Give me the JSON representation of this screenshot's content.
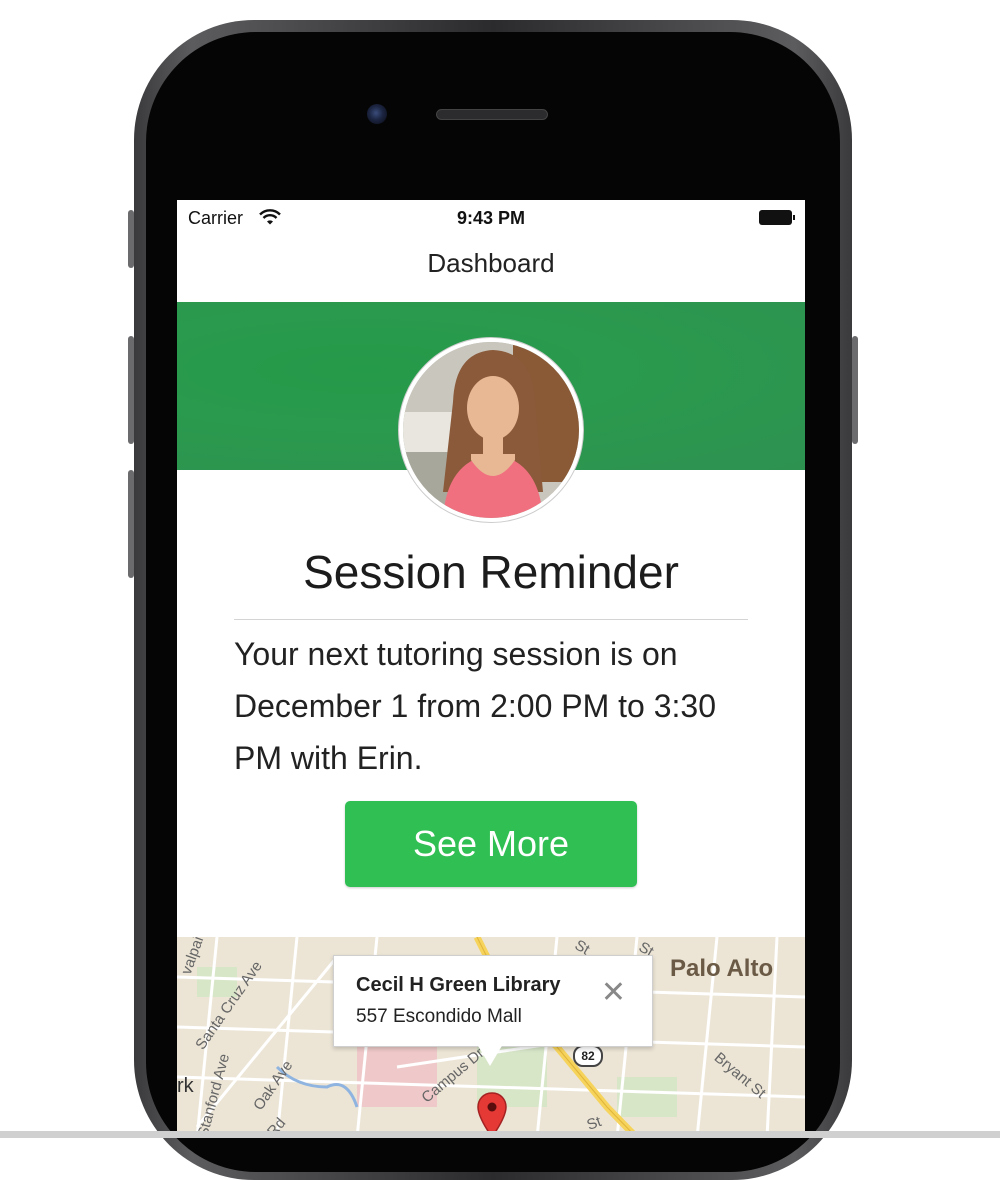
{
  "status_bar": {
    "carrier": "Carrier",
    "time": "9:43 PM"
  },
  "nav": {
    "title": "Dashboard"
  },
  "card": {
    "title": "Session Reminder",
    "message": "Your next tutoring session is on December 1 from 2:00 PM to 3:30 PM with Erin.",
    "button_label": "See More"
  },
  "map": {
    "city": "Palo Alto",
    "popup_title": "Cecil H Green Library",
    "popup_address": "557 Escondido Mall",
    "close_symbol": "✕",
    "streets": {
      "s1": "valpai",
      "s2": "Santa Cruz Ave",
      "s3": "Stanford Ave",
      "s4": "Oak Ave",
      "s5": "Rd",
      "s6": "rk",
      "s7": "Campus Dr",
      "s8": "82",
      "s9": "Bryant St",
      "s10": "St",
      "s11": "St",
      "s12": "St"
    }
  },
  "colors": {
    "banner": "#2a9a4e",
    "button": "#2fbf53",
    "pin": "#e53935"
  },
  "icons": [
    "wifi-icon",
    "battery-icon",
    "close-icon",
    "map-pin-icon"
  ]
}
